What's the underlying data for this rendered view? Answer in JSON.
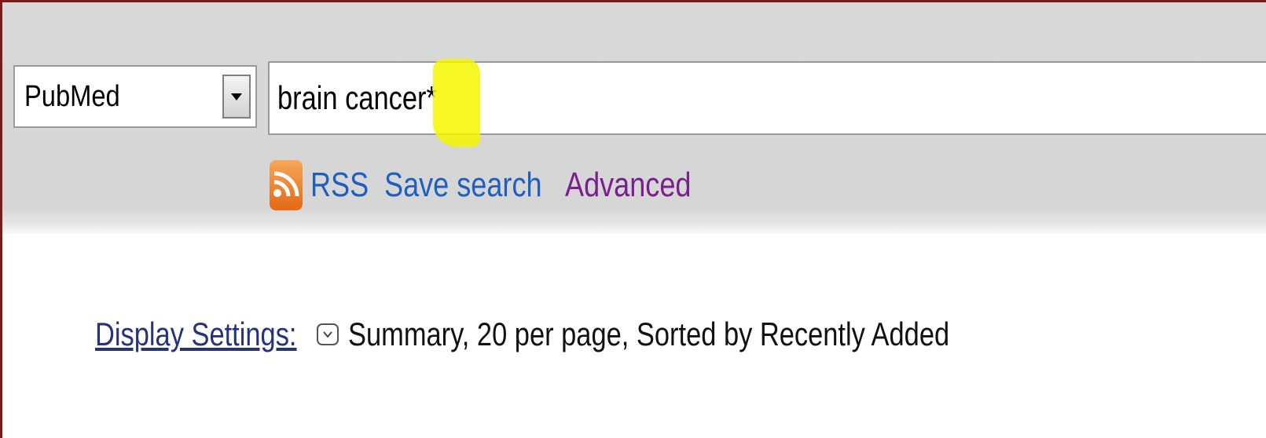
{
  "search": {
    "database": "PubMed",
    "query": "brain cancer*"
  },
  "links": {
    "rss": "RSS",
    "save_search": "Save search",
    "advanced": "Advanced"
  },
  "display_settings": {
    "label": "Display Settings:",
    "summary": "Summary, 20 per page, Sorted by Recently Added"
  },
  "icons": {
    "dropdown": "triangle-down-icon",
    "rss": "rss-feed-icon",
    "display_toggle": "chevron-down-icon"
  },
  "colors": {
    "link_blue": "#1f5fbf",
    "link_visited": "#7a1f8f",
    "label_navy": "#26337a",
    "highlight": "#f6f600",
    "frame": "#7a1a1a",
    "band": "#d6d6d6"
  }
}
